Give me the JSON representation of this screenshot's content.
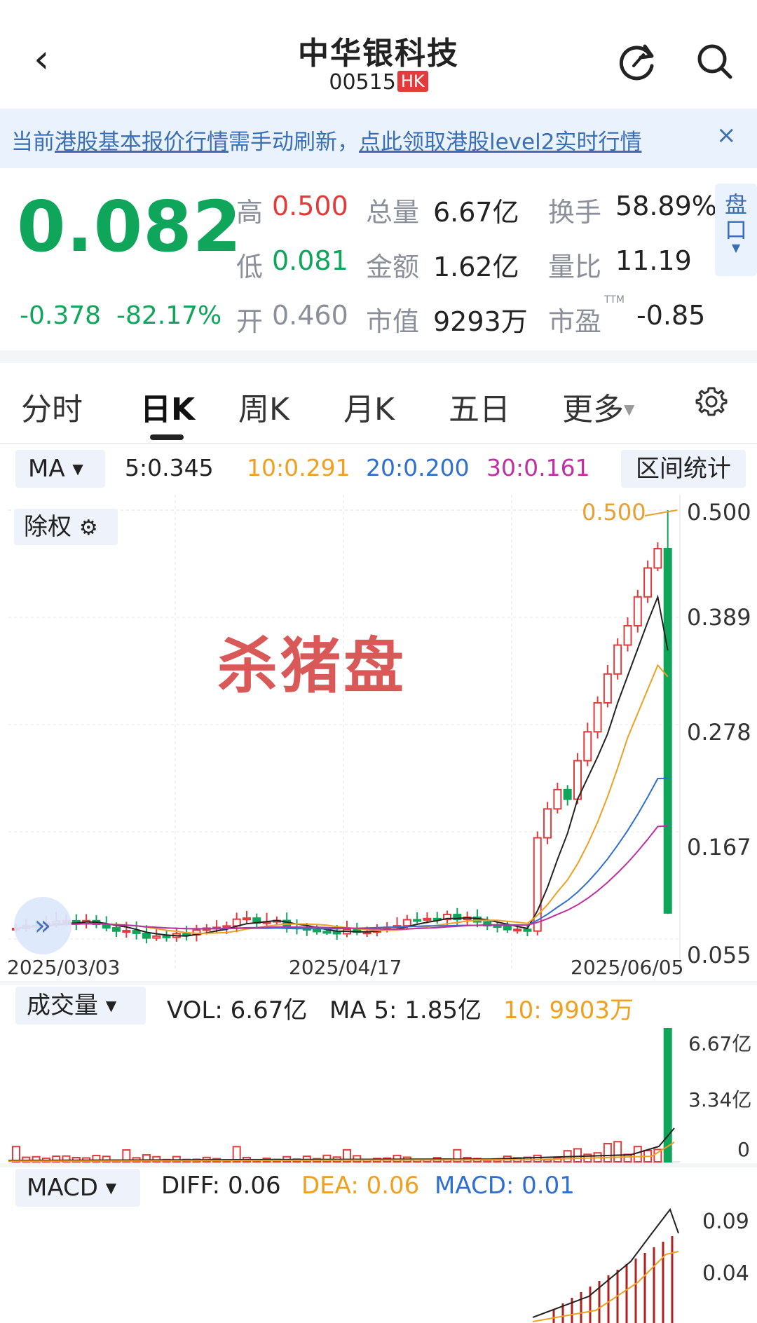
{
  "header": {
    "title": "中华银科技",
    "code": "00515",
    "market_badge": "HK",
    "back_icon": "chevron-left-icon",
    "refresh_icon": "refresh-icon",
    "search_icon": "search-icon"
  },
  "banner": {
    "text_a": "当前",
    "text_link1": "港股基本报价行情",
    "text_b": "需手动刷新，",
    "text_link2": "点此领取港股level2实时行情",
    "close": "×"
  },
  "quote": {
    "price": "0.082",
    "change": "-0.378",
    "change_pct": "-82.17%",
    "high_label": "高",
    "high": "0.500",
    "low_label": "低",
    "low": "0.081",
    "open_label": "开",
    "open": "0.460",
    "volume_label": "总量",
    "volume": "6.67亿",
    "amount_label": "金额",
    "amount": "1.62亿",
    "mktcap_label": "市值",
    "mktcap": "9293万",
    "turnover_label": "换手",
    "turnover": "58.89%",
    "volratio_label": "量比",
    "volratio": "11.19",
    "pe_label": "市盈",
    "pe_sup": "TTM",
    "pe": "-0.85",
    "pankou": "盘口"
  },
  "tabs": [
    "分时",
    "日K",
    "周K",
    "月K",
    "五日",
    "更多"
  ],
  "ma_bar": {
    "selector": "MA",
    "ma5": "5:0.345",
    "ma10": "10:0.291",
    "ma20": "20:0.200",
    "ma30": "30:0.161",
    "interval_stats": "区间统计"
  },
  "main_chart": {
    "adjust_label": "除权",
    "watermark": "杀猪盘",
    "high_marker": "0.500",
    "y_ticks": [
      "0.500",
      "0.389",
      "0.278",
      "0.167",
      "0.055"
    ],
    "dates": [
      "2025/03/03",
      "2025/04/17",
      "2025/06/05"
    ]
  },
  "volume_panel": {
    "selector": "成交量",
    "vol": "VOL: 6.67亿",
    "ma5": "MA 5: 1.85亿",
    "ma10": "10: 9903万",
    "y_ticks": [
      "6.67亿",
      "3.34亿",
      "0"
    ]
  },
  "macd_panel": {
    "selector": "MACD",
    "diff": "DIFF: 0.06",
    "dea": "DEA: 0.06",
    "macd": "MACD: 0.01",
    "y_ticks": [
      "0.09",
      "0.04"
    ]
  },
  "colors": {
    "up": "#e33b3b",
    "down": "#0fa55b",
    "ma5": "#222222",
    "ma10": "#f0a020",
    "ma20": "#2f6fd0",
    "ma30": "#c030a0",
    "accent": "#3b6fb5"
  },
  "chart_data": {
    "type": "candlestick",
    "x_range": [
      "2025/03/03",
      "2025/06/05"
    ],
    "ylim": [
      0.055,
      0.5
    ],
    "last_candle": {
      "open": 0.46,
      "high": 0.5,
      "low": 0.081,
      "close": 0.082
    },
    "recent_closes_approx": [
      0.16,
      0.19,
      0.21,
      0.2,
      0.24,
      0.27,
      0.3,
      0.33,
      0.36,
      0.38,
      0.41,
      0.44,
      0.46,
      0.082
    ],
    "ma_latest": {
      "MA5": 0.345,
      "MA10": 0.291,
      "MA20": 0.2,
      "MA30": 0.161
    }
  }
}
